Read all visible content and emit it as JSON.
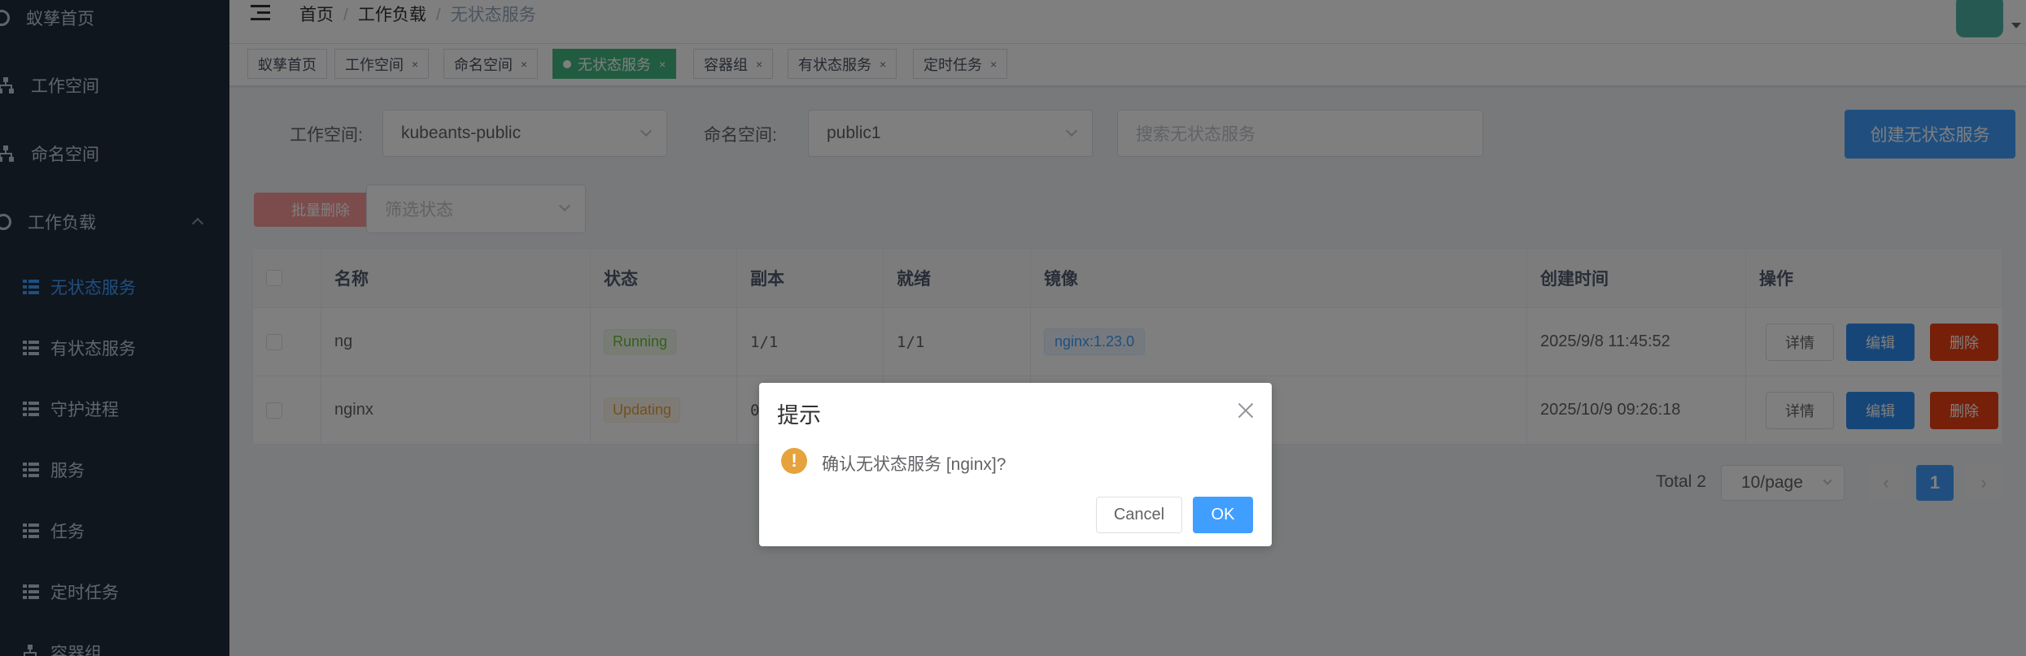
{
  "sidebar": {
    "items": [
      {
        "label": "蚁孳首页",
        "icon": "dashboard-icon"
      },
      {
        "label": "工作空间",
        "icon": "tree-icon"
      },
      {
        "label": "命名空间",
        "icon": "tree-icon"
      },
      {
        "label": "工作负载",
        "icon": "workload-icon",
        "expanded": true
      },
      {
        "label": "无状态服务",
        "icon": "table-icon",
        "active": true
      },
      {
        "label": "有状态服务",
        "icon": "table-icon"
      },
      {
        "label": "守护进程",
        "icon": "table-icon"
      },
      {
        "label": "服务",
        "icon": "table-icon"
      },
      {
        "label": "任务",
        "icon": "table-icon"
      },
      {
        "label": "定时任务",
        "icon": "table-icon"
      },
      {
        "label": "容器组",
        "icon": "tree-icon"
      }
    ]
  },
  "breadcrumb": [
    "首页",
    "工作负载",
    "无状态服务"
  ],
  "tags": [
    {
      "label": "蚁孳首页",
      "closable": false
    },
    {
      "label": "工作空间",
      "closable": true
    },
    {
      "label": "命名空间",
      "closable": true
    },
    {
      "label": "无状态服务",
      "closable": true,
      "active": true
    },
    {
      "label": "容器组",
      "closable": true
    },
    {
      "label": "有状态服务",
      "closable": true
    },
    {
      "label": "定时任务",
      "closable": true
    }
  ],
  "close_glyph": "×",
  "filters": {
    "workspace_label": "工作空间:",
    "workspace_value": "kubeants-public",
    "namespace_label": "命名空间:",
    "namespace_value": "public1",
    "search_placeholder": "搜索无状态服务",
    "create_label": "创建无状态服务",
    "batch_delete_label": "批量删除",
    "status_placeholder": "筛选状态"
  },
  "table": {
    "columns": [
      "名称",
      "状态",
      "副本",
      "就绪",
      "镜像",
      "创建时间",
      "操作"
    ],
    "rows": [
      {
        "name": "ng",
        "status": "Running",
        "replicas": "1/1",
        "ready": "1/1",
        "image": "nginx:1.23.0",
        "created": "2025/9/8 11:45:52"
      },
      {
        "name": "nginx",
        "status": "Updating",
        "replicas": "0",
        "ready": "",
        "image": "",
        "created": "2025/10/9 09:26:18"
      }
    ],
    "actions": {
      "detail": "详情",
      "edit": "编辑",
      "delete": "删除"
    }
  },
  "pagination": {
    "total": "Total 2",
    "page_size": "10/page",
    "current": "1",
    "prev": "‹",
    "next": "›"
  },
  "dialog": {
    "title": "提示",
    "message": "确认无状态服务 [nginx]?",
    "warn_glyph": "!",
    "cancel": "Cancel",
    "ok": "OK"
  },
  "colors": {
    "sidebar_bg": "#1f2d3d",
    "accent": "#409eff",
    "active_tag": "#42b983",
    "danger": "#ed4014",
    "warning": "#e6a23c"
  }
}
